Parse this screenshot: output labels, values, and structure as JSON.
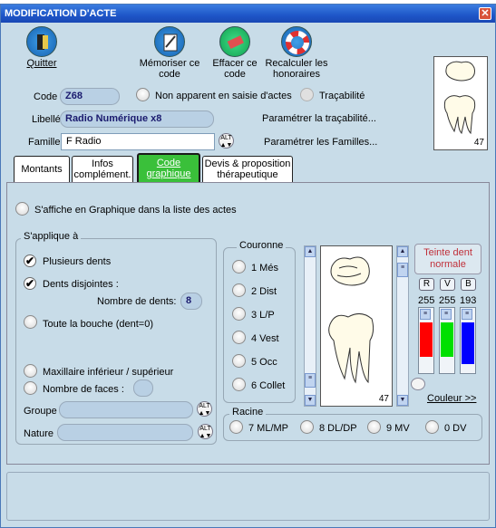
{
  "window": {
    "title": "MODIFICATION D'ACTE",
    "close_glyph": "✕"
  },
  "toolbar": {
    "quit": "Quitter",
    "memorize_l1": "Mémoriser ce",
    "memorize_l2": "code",
    "erase_l1": "Effacer ce",
    "erase_l2": "code",
    "recalc_l1": "Recalculer les",
    "recalc_l2": "honoraires"
  },
  "form": {
    "code_label": "Code",
    "code_value": "Z68",
    "non_apparent": "Non apparent en saisie d'actes",
    "tracabilite": "Traçabilité",
    "libelle_label": "Libellé",
    "libelle_value": "Radio Numérique x8",
    "param_trac": "Paramétrer la traçabilité...",
    "famille_label": "Famille",
    "famille_value": "F Radio",
    "param_fam": "Paramétrer les Familles...",
    "alt_l1": "ALT",
    "alt_l2": "▲▼",
    "tooth_number": "47"
  },
  "tabs": {
    "montants": "Montants",
    "infos_l1": "Infos",
    "infos_l2": "complément.",
    "code_l1": "Code",
    "code_l2": "graphique",
    "devis_l1": "Devis & proposition",
    "devis_l2": "thérapeutique"
  },
  "graphic": {
    "affiche": "S'affiche en Graphique dans la liste des actes",
    "applique_title": "S'applique à",
    "plusieurs": "Plusieurs dents",
    "disjointes": "Dents disjointes :",
    "nombre_dents_label": "Nombre de dents:",
    "nombre_dents_value": "8",
    "toute": "Toute la bouche (dent=0)",
    "maxillaire": "Maxillaire inférieur / supérieur",
    "nombre_faces": "Nombre de faces :",
    "groupe": "Groupe",
    "nature": "Nature",
    "couronne_title": "Couronne",
    "couronne": [
      "1 Més",
      "2 Dist",
      "3 L/P",
      "4 Vest",
      "5 Occ",
      "6 Collet"
    ],
    "tooth_number": "47",
    "teinte_l1": "Teinte dent",
    "teinte_l2": "normale",
    "channels": [
      "R",
      "V",
      "B"
    ],
    "values": [
      "255",
      "255",
      "193"
    ],
    "couleur": "Couleur >>",
    "racine_title": "Racine",
    "racine": [
      "7 ML/MP",
      "8 DL/DP",
      "9 MV",
      "0 DV"
    ]
  },
  "colors": {
    "accent_green": "#3ac03a",
    "title_blue": "#1e56c8",
    "slider_r": "#ff0000",
    "slider_g": "#00e000",
    "slider_b": "#0000ff"
  }
}
